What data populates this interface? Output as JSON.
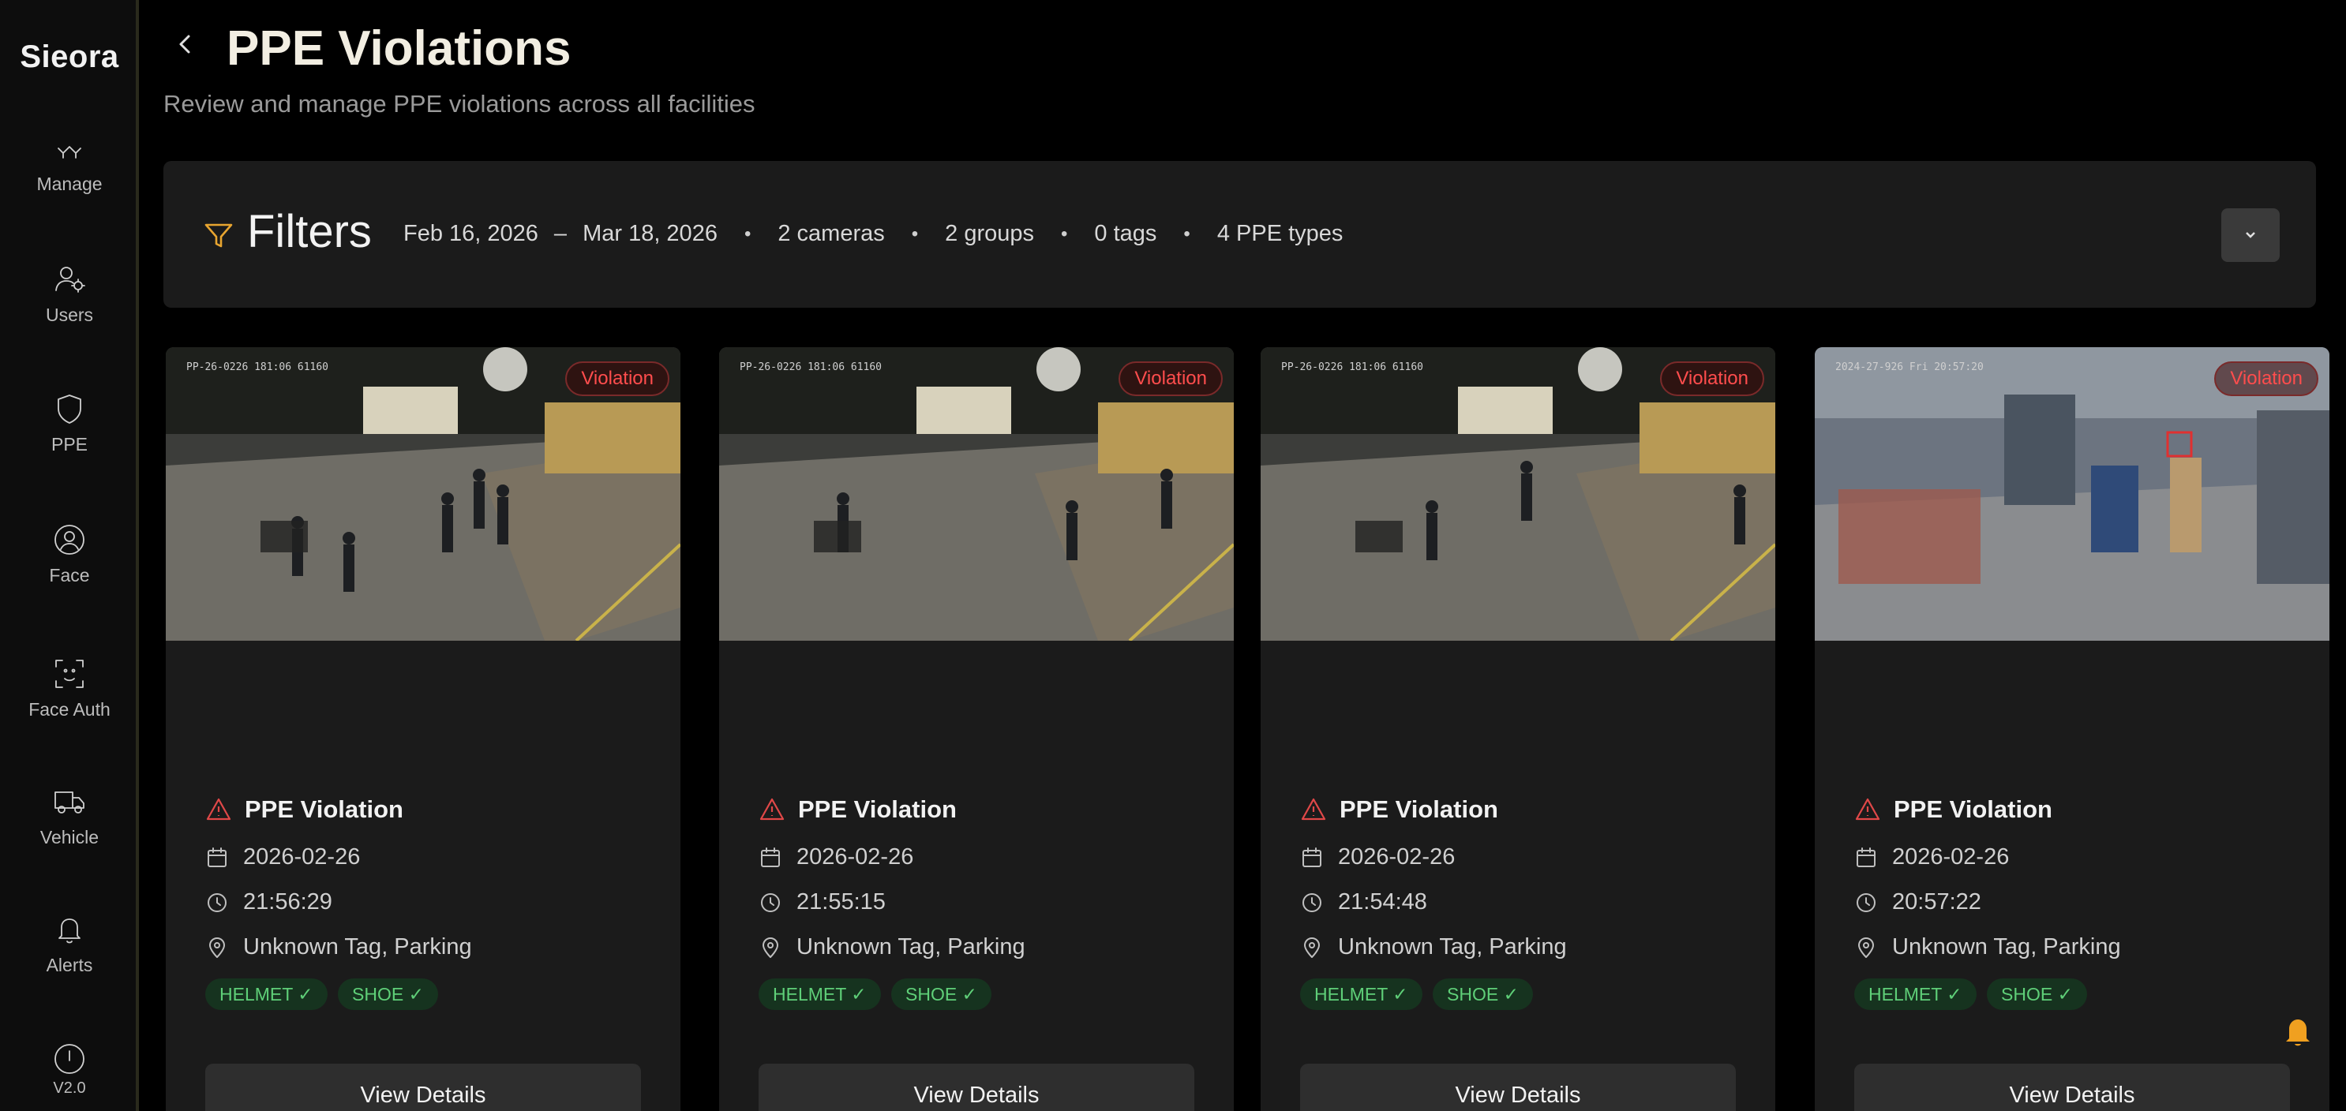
{
  "sidebar": {
    "brand": "Sieora",
    "items": [
      {
        "label": "Manage",
        "icon": "manage-icon"
      },
      {
        "label": "Users",
        "icon": "users-icon"
      },
      {
        "label": "PPE",
        "icon": "shield-icon"
      },
      {
        "label": "Face",
        "icon": "face-icon"
      },
      {
        "label": "Face Auth",
        "icon": "face-scan-icon"
      },
      {
        "label": "Vehicle",
        "icon": "truck-icon"
      },
      {
        "label": "Alerts",
        "icon": "bell-icon"
      },
      {
        "label": "V2.0",
        "icon": "info-icon"
      }
    ]
  },
  "header": {
    "title": "PPE Violations",
    "subtitle": "Review and manage PPE violations across all facilities"
  },
  "filters": {
    "title": "Filters",
    "date_start": "Feb 16, 2026",
    "date_sep": "–",
    "date_end": "Mar 18, 2026",
    "cameras": "2 cameras",
    "groups": "2 groups",
    "tags": "0 tags",
    "ppe_types": "4 PPE types"
  },
  "cards": [
    {
      "badge": "Violation",
      "overlay": "PP-26-0226 181:06 61160",
      "title": "PPE Violation",
      "date": "2026-02-26",
      "time": "21:56:29",
      "location": "Unknown Tag, Parking",
      "tags": [
        "HELMET ✓",
        "SHOE ✓"
      ],
      "button": "View Details"
    },
    {
      "badge": "Violation",
      "overlay": "PP-26-0226 181:06 61160",
      "title": "PPE Violation",
      "date": "2026-02-26",
      "time": "21:55:15",
      "location": "Unknown Tag, Parking",
      "tags": [
        "HELMET ✓",
        "SHOE ✓"
      ],
      "button": "View Details"
    },
    {
      "badge": "Violation",
      "overlay": "PP-26-0226 181:06 61160",
      "title": "PPE Violation",
      "date": "2026-02-26",
      "time": "21:54:48",
      "location": "Unknown Tag, Parking",
      "tags": [
        "HELMET ✓",
        "SHOE ✓"
      ],
      "button": "View Details"
    },
    {
      "badge": "Violation",
      "overlay": "2024-27-926 Fri 20:57:20",
      "title": "PPE Violation",
      "date": "2026-02-26",
      "time": "20:57:22",
      "location": "Unknown Tag, Parking",
      "tags": [
        "HELMET ✓",
        "SHOE ✓"
      ],
      "button": "View Details"
    }
  ],
  "colors": {
    "accent": "#e8a530",
    "violation": "#ff4d4d",
    "tag_text": "#5fcf78",
    "tag_bg": "#16331f"
  }
}
